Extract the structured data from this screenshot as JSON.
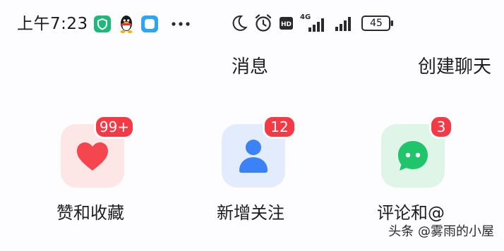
{
  "status_bar": {
    "time": "上午7:23",
    "battery_level": "45",
    "network": "4G",
    "hd_label": "HD",
    "notification_icons": [
      "shield-app-icon",
      "qq-penguin-icon",
      "app-square-icon",
      "more-dots-icon"
    ],
    "system_icons": [
      "moon-icon",
      "alarm-icon",
      "hd-icon",
      "signal-4g-icon",
      "signal-icon",
      "battery-icon"
    ]
  },
  "header": {
    "title": "消息",
    "create_chat_label": "创建聊天"
  },
  "shortcuts": [
    {
      "label": "赞和收藏",
      "badge": "99+",
      "icon": "heart-icon",
      "color": "#f5464f"
    },
    {
      "label": "新增关注",
      "badge": "12",
      "icon": "person-icon",
      "color": "#3b82f6"
    },
    {
      "label": "评论和@",
      "badge": "3",
      "icon": "chat-bubble-icon",
      "color": "#1fc46b"
    }
  ],
  "colors": {
    "badge": "#f53a46",
    "likes_tile": "#fde6e6",
    "follows_tile": "#e3ecfd",
    "comments_tile": "#def5e8"
  },
  "watermark": "头条 @雾雨的小屋"
}
